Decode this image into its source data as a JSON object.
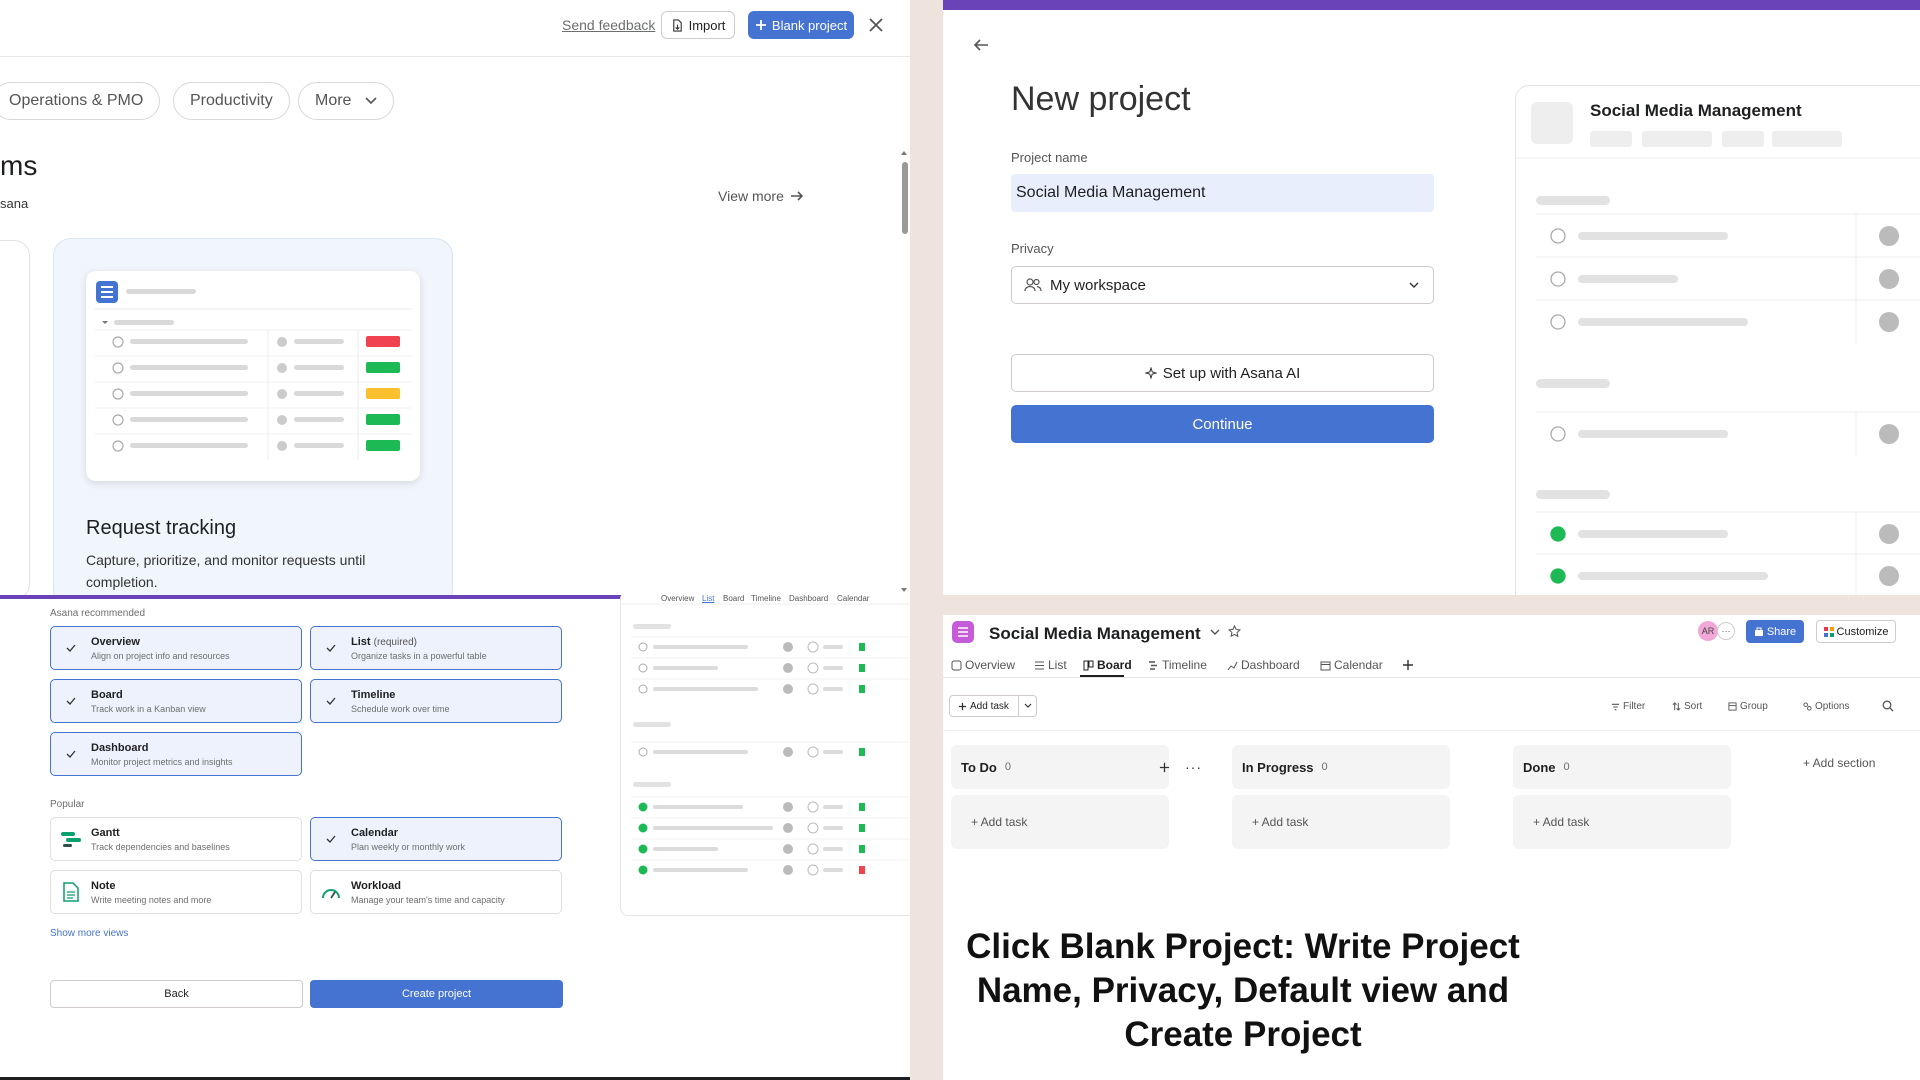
{
  "template_gallery": {
    "send_feedback": "Send feedback",
    "import_label": "Import",
    "blank_project_label": "Blank project",
    "categories": [
      "Operations & PMO",
      "Productivity",
      "More"
    ],
    "section_heading": "ms",
    "section_sub": "sana",
    "view_more": "View more",
    "template": {
      "title": "Request tracking",
      "description": "Capture, prioritize, and monitor requests until completion."
    }
  },
  "new_project": {
    "title": "New project",
    "name_label": "Project name",
    "name_value": "Social Media Management",
    "privacy_label": "Privacy",
    "privacy_value": "My workspace",
    "ai_button": "Set up with Asana AI",
    "continue_button": "Continue",
    "preview_title": "Social Media Management"
  },
  "default_views": {
    "recommended_label": "Asana recommended",
    "recommended": [
      {
        "title": "Overview",
        "desc": "Align on project info and resources",
        "selected": true
      },
      {
        "title": "List",
        "required": "(required)",
        "desc": "Organize tasks in a powerful table",
        "selected": true
      },
      {
        "title": "Board",
        "desc": "Track work in a Kanban view",
        "selected": true
      },
      {
        "title": "Timeline",
        "desc": "Schedule work over time",
        "selected": true
      },
      {
        "title": "Dashboard",
        "desc": "Monitor project metrics and insights",
        "selected": true
      }
    ],
    "popular_label": "Popular",
    "popular": [
      {
        "title": "Gantt",
        "desc": "Track dependencies and baselines",
        "selected": false
      },
      {
        "title": "Calendar",
        "desc": "Plan weekly or monthly work",
        "selected": true
      },
      {
        "title": "Note",
        "desc": "Write meeting notes and more",
        "selected": false
      },
      {
        "title": "Workload",
        "desc": "Manage your team's time and capacity",
        "selected": false
      }
    ],
    "show_more": "Show more views",
    "back_button": "Back",
    "create_button": "Create project",
    "preview_tabs": [
      "Overview",
      "List",
      "Board",
      "Timeline",
      "Dashboard",
      "Calendar"
    ]
  },
  "board": {
    "project_title": "Social Media Management",
    "avatar_initials": "AR",
    "share_label": "Share",
    "customize_label": "Customize",
    "tabs": [
      "Overview",
      "List",
      "Board",
      "Timeline",
      "Dashboard",
      "Calendar"
    ],
    "active_tab": "Board",
    "add_task_label": "Add task",
    "tools": [
      "Filter",
      "Sort",
      "Group",
      "Options"
    ],
    "columns": [
      {
        "name": "To Do",
        "count": "0"
      },
      {
        "name": "In Progress",
        "count": "0"
      },
      {
        "name": "Done",
        "count": "0"
      }
    ],
    "column_add_task": "+ Add task",
    "add_section": "+ Add section"
  },
  "caption": "Click Blank Project: Write Project Name, Privacy, Default view and Create Project",
  "colors": {
    "accent": "#4573d2",
    "purple": "#6b43b8",
    "background": "#efe3de"
  }
}
